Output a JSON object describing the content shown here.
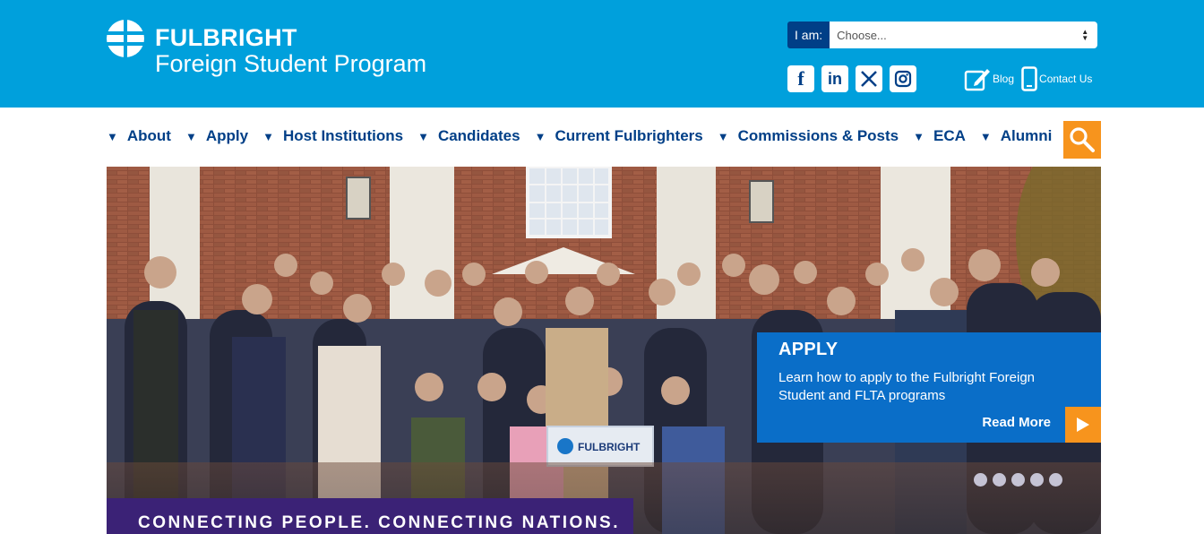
{
  "brand": {
    "name": "FULBRIGHT",
    "subtitle": "Foreign Student Program"
  },
  "iam": {
    "label": "I am:",
    "selected": "Choose..."
  },
  "social": [
    {
      "icon": "facebook-icon",
      "glyph": "f"
    },
    {
      "icon": "linkedin-icon",
      "glyph": "in"
    },
    {
      "icon": "x-twitter-icon",
      "glyph": "X"
    },
    {
      "icon": "instagram-icon",
      "glyph": "◎"
    }
  ],
  "links": {
    "blog": "Blog",
    "contact": "Contact Us"
  },
  "nav": [
    {
      "label": "About"
    },
    {
      "label": "Apply"
    },
    {
      "label": "Host Institutions"
    },
    {
      "label": "Candidates"
    },
    {
      "label": "Current Fulbrighters"
    },
    {
      "label": "Commissions & Posts"
    },
    {
      "label": "ECA"
    },
    {
      "label": "Alumni"
    }
  ],
  "hero": {
    "banner_text": "FULBRIGHT",
    "apply": {
      "title": "APPLY",
      "text": "Learn how to apply to the Fulbright Foreign Student and FLTA programs",
      "read_more": "Read More"
    },
    "slides_count": 5,
    "tagline": "CONNECTING PEOPLE. CONNECTING NATIONS."
  },
  "colors": {
    "header_bg": "#00a0dc",
    "nav_text": "#003f87",
    "accent_orange": "#f7941d",
    "apply_bg": "#0a6ec8",
    "tagline_bg": "#3b2276"
  }
}
